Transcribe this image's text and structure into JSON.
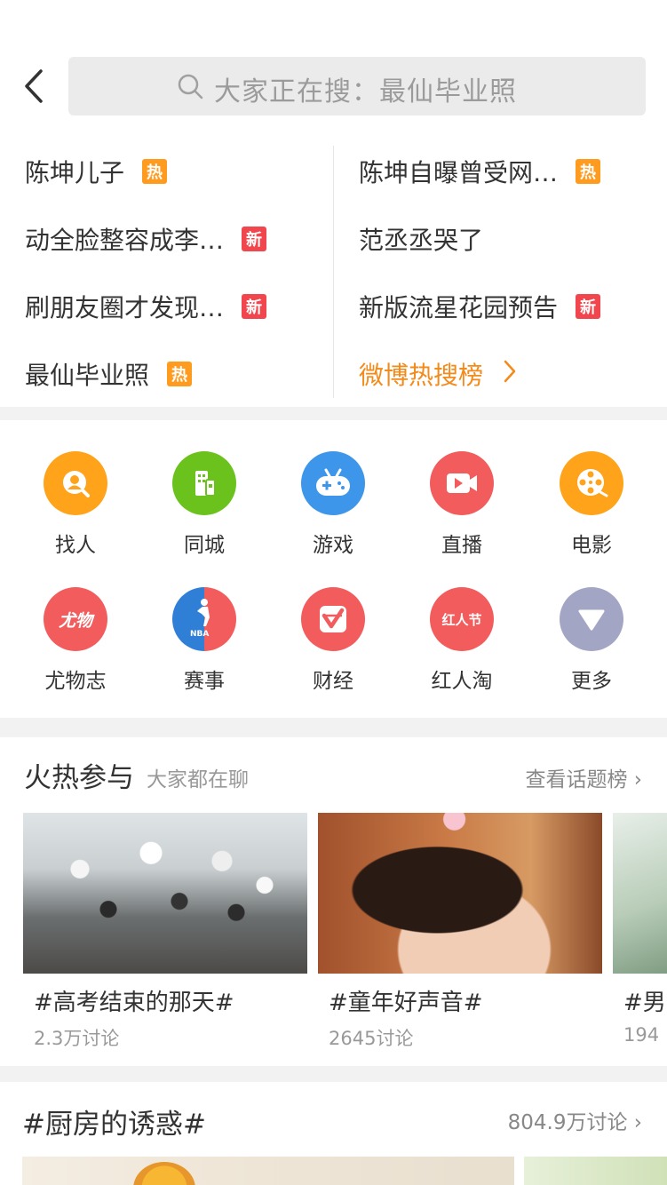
{
  "search": {
    "placeholder": "大家正在搜：最仙毕业照"
  },
  "hot_searches": {
    "left": [
      {
        "text": "陈坤儿子",
        "badge": "热",
        "badge_type": "hot"
      },
      {
        "text": "动全脸整容成李…",
        "badge": "新",
        "badge_type": "new"
      },
      {
        "text": "刷朋友圈才发现…",
        "badge": "新",
        "badge_type": "new"
      },
      {
        "text": "最仙毕业照",
        "badge": "热",
        "badge_type": "hot"
      }
    ],
    "right": [
      {
        "text": "陈坤自曝曾受网…",
        "badge": "热",
        "badge_type": "hot"
      },
      {
        "text": "范丞丞哭了",
        "badge": "",
        "badge_type": ""
      },
      {
        "text": "新版流星花园预告",
        "badge": "新",
        "badge_type": "new"
      }
    ],
    "more_label": "微博热搜榜",
    "more_arrow": "›"
  },
  "categories": [
    {
      "label": "找人",
      "icon": "find-people-icon",
      "color": "#ffa31a"
    },
    {
      "label": "同城",
      "icon": "city-icon",
      "color": "#6bc21c"
    },
    {
      "label": "游戏",
      "icon": "gamepad-icon",
      "color": "#3d96ea"
    },
    {
      "label": "直播",
      "icon": "live-video-icon",
      "color": "#f25c5c"
    },
    {
      "label": "电影",
      "icon": "film-reel-icon",
      "color": "#ffa31a"
    },
    {
      "label": "尤物志",
      "icon": "youwu-logo-icon",
      "color": "#f25c5c",
      "glyph": "尤物"
    },
    {
      "label": "赛事",
      "icon": "nba-logo-icon",
      "color": "#f25c5c",
      "glyph": "NBA"
    },
    {
      "label": "财经",
      "icon": "finance-icon",
      "color": "#f25c5c"
    },
    {
      "label": "红人淘",
      "icon": "hongrenjie-logo-icon",
      "color": "#f25c5c",
      "glyph": "红人节"
    },
    {
      "label": "更多",
      "icon": "more-triangle-icon",
      "color": "#a3a5c4"
    }
  ],
  "topics_section": {
    "title": "火热参与",
    "subtitle": "大家都在聊",
    "link": "查看话题榜 ›",
    "cards": [
      {
        "title": "#高考结束的那天#",
        "count": "2.3万讨论"
      },
      {
        "title": "#童年好声音#",
        "count": "2645讨论"
      },
      {
        "title": "#男",
        "count": "194"
      }
    ]
  },
  "kitchen_section": {
    "title": "#厨房的诱惑#",
    "count": "804.9万讨论 ›"
  },
  "colors": {
    "accent_orange": "#f38a1a",
    "hot_badge": "#ff9b1e",
    "new_badge": "#f2464e"
  }
}
